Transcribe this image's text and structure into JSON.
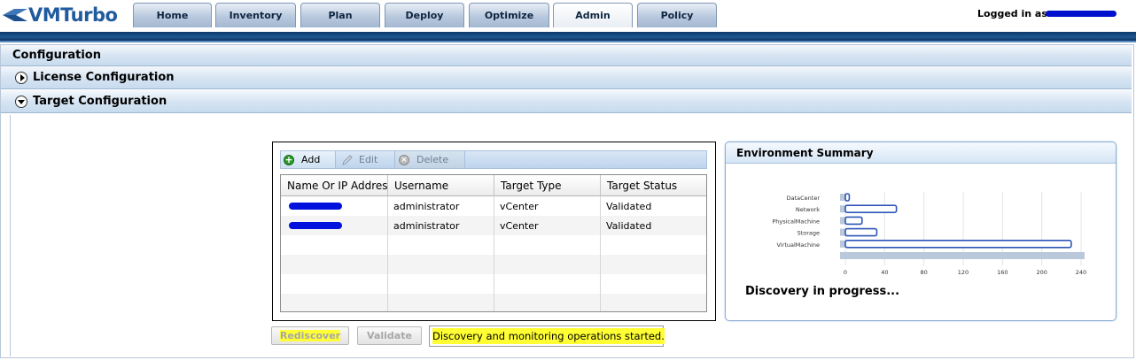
{
  "app": {
    "logo_text": "VMTurbo",
    "tabs": [
      {
        "label": "Home"
      },
      {
        "label": "Inventory"
      },
      {
        "label": "Plan"
      },
      {
        "label": "Deploy"
      },
      {
        "label": "Optimize"
      },
      {
        "label": "Admin"
      },
      {
        "label": "Policy"
      }
    ],
    "active_tab": "Admin",
    "login_label": "Logged in as:",
    "accent_color": "#1f5b9e"
  },
  "config": {
    "title": "Configuration",
    "sections": [
      {
        "label": "License Configuration",
        "expanded": false
      },
      {
        "label": "Target Configuration",
        "expanded": true
      }
    ]
  },
  "targets": {
    "toolbar": {
      "add": "Add",
      "edit": "Edit",
      "delete": "Delete"
    },
    "columns": [
      "Name Or IP Address",
      "Username",
      "Target Type",
      "Target Status"
    ],
    "rows": [
      {
        "name": "",
        "username": "administrator",
        "type": "vCenter",
        "status": "Validated"
      },
      {
        "name": "",
        "username": "administrator",
        "type": "vCenter",
        "status": "Validated"
      }
    ],
    "empty_rows": 4,
    "rediscover_label": "Rediscover",
    "validate_label": "Validate",
    "status_message": "Discovery and monitoring operations started."
  },
  "environment": {
    "title": "Environment Summary",
    "status": "Discovery in progress..."
  },
  "chart_data": {
    "type": "bar",
    "orientation": "horizontal",
    "categories": [
      "DataCenter",
      "Network",
      "PhysicalMachine",
      "Storage",
      "VirtualMachine"
    ],
    "values": [
      4,
      52,
      17,
      32,
      230
    ],
    "xlim": [
      0,
      240
    ],
    "ticks": [
      0,
      40,
      80,
      120,
      160,
      200,
      240
    ],
    "bar_color": "#2e56b8",
    "track_color": "#b9c8da",
    "grid": true
  }
}
